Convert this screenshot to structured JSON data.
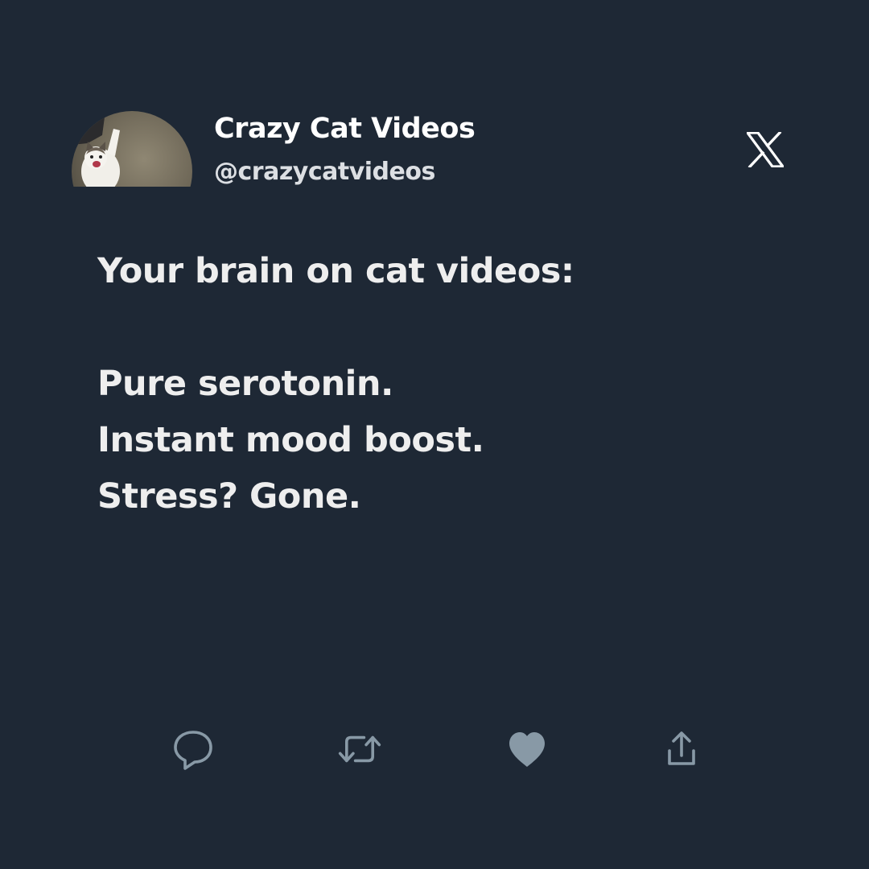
{
  "profile": {
    "display_name": "Crazy Cat Videos",
    "handle": "@crazycatvideos",
    "avatar": "cat-photo-avatar"
  },
  "brand_icon": "x-logo-icon",
  "tweet": {
    "lines": [
      "Your brain on cat videos:",
      "",
      "Pure serotonin.",
      "Instant mood boost.",
      "Stress? Gone."
    ]
  },
  "actions": [
    {
      "icon": "reply-icon"
    },
    {
      "icon": "retweet-icon"
    },
    {
      "icon": "like-icon"
    },
    {
      "icon": "share-icon"
    }
  ],
  "colors": {
    "background": "#1e2835",
    "text": "#eeeeee",
    "icon": "#8899a6"
  }
}
